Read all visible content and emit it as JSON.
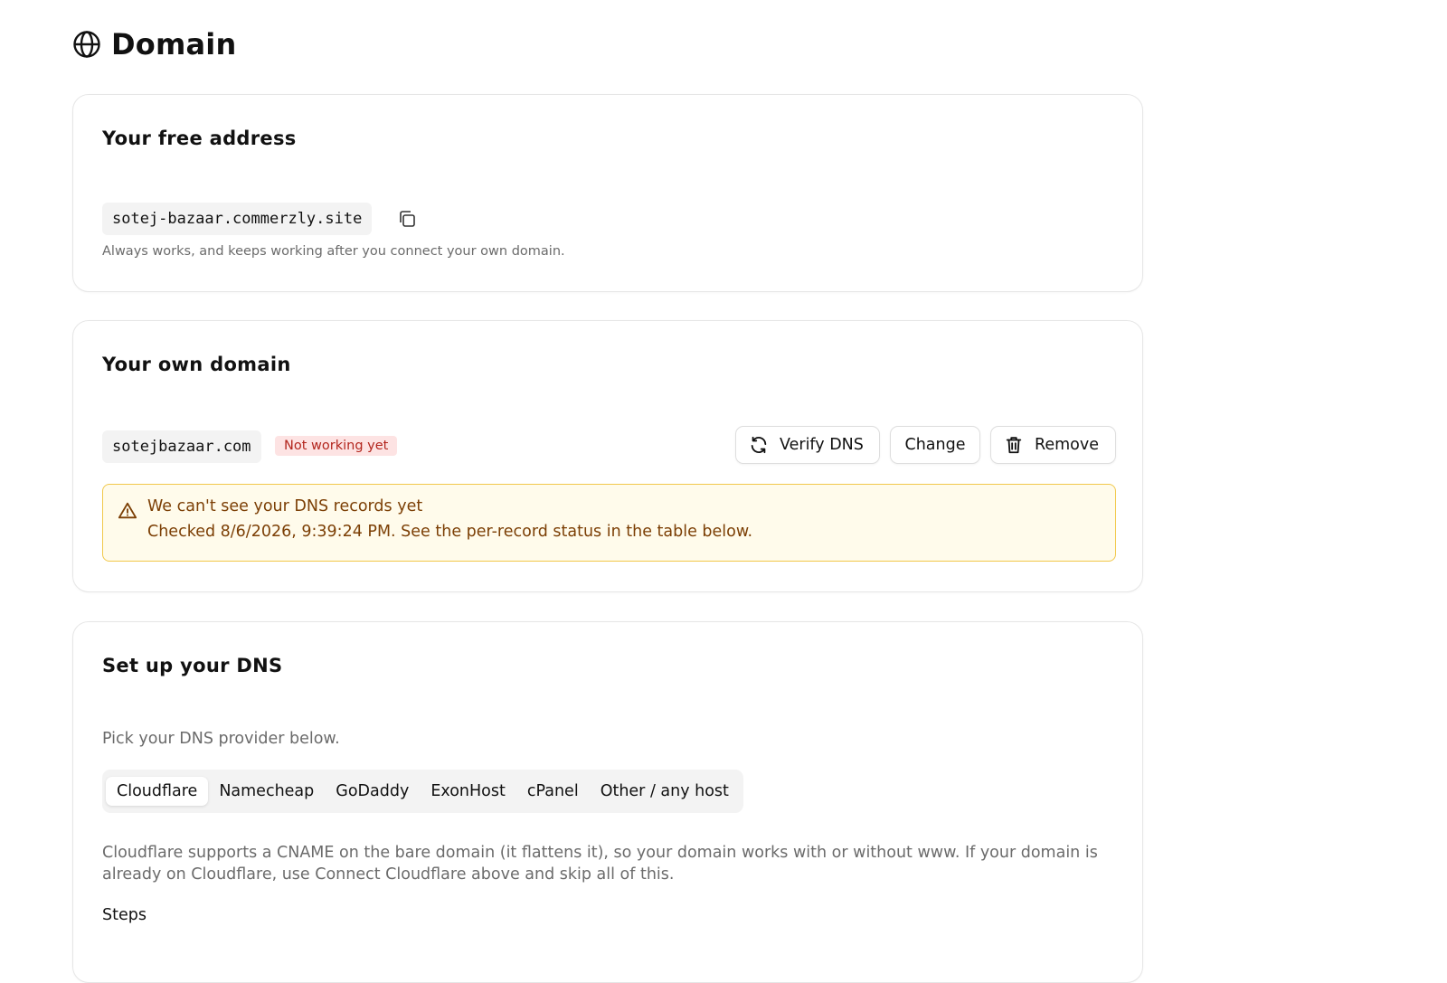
{
  "page": {
    "title": "Domain"
  },
  "free_address": {
    "title": "Your free address",
    "address": "sotej-bazaar.commerzly.site",
    "hint": "Always works, and keeps working after you connect your own domain."
  },
  "own_domain": {
    "title": "Your own domain",
    "domain": "sotejbazaar.com",
    "status_badge": "Not working yet",
    "buttons": {
      "verify": "Verify DNS",
      "change": "Change",
      "remove": "Remove"
    },
    "alert": {
      "title": "We can't see your DNS records yet",
      "detail": "Checked 8/6/2026, 9:39:24 PM. See the per-record status in the table below."
    }
  },
  "dns_setup": {
    "title": "Set up your DNS",
    "subtitle": "Pick your DNS provider below.",
    "providers": [
      "Cloudflare",
      "Namecheap",
      "GoDaddy",
      "ExonHost",
      "cPanel",
      "Other / any host"
    ],
    "selected_provider": "Cloudflare",
    "description": "Cloudflare supports a CNAME on the bare domain (it flattens it), so your domain works with or without www. If your domain is already on Cloudflare, use Connect Cloudflare above and skip all of this.",
    "steps_label": "Steps"
  },
  "colors": {
    "badge_bg": "#fde3e3",
    "badge_text": "#b3261e",
    "alert_bg": "#fffbeb",
    "alert_border": "#f1c84b",
    "alert_text": "#7c3f05"
  },
  "icons": [
    "globe-icon",
    "copy-icon",
    "refresh-icon",
    "trash-icon",
    "warning-icon"
  ]
}
